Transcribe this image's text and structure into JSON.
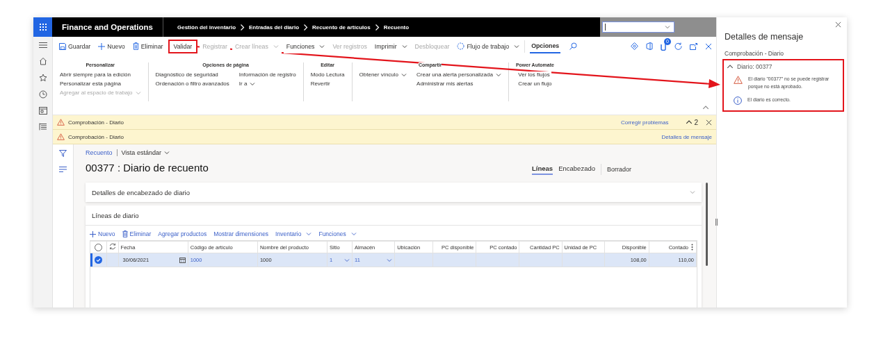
{
  "app": {
    "title": "Finance and Operations",
    "breadcrumbs": [
      "Gestión del inventario",
      "Entradas del diario",
      "Recuento de artículos",
      "Recuento"
    ],
    "notifications": "0"
  },
  "toolbar": {
    "actions": [
      {
        "kind": "save",
        "label": "Guardar",
        "disabled": false,
        "dropdown": false,
        "highlighted": false
      },
      {
        "kind": "add",
        "label": "Nuevo",
        "disabled": false,
        "dropdown": false,
        "highlighted": false
      },
      {
        "kind": "delete",
        "label": "Eliminar",
        "disabled": false,
        "dropdown": false,
        "highlighted": false
      },
      {
        "kind": "text",
        "label": "Validar",
        "disabled": false,
        "dropdown": false,
        "highlighted": true
      },
      {
        "kind": "text",
        "label": "Registrar",
        "disabled": true,
        "dropdown": false,
        "highlighted": false
      },
      {
        "kind": "text",
        "label": "Crear líneas",
        "disabled": true,
        "dropdown": true,
        "highlighted": false
      },
      {
        "kind": "text",
        "label": "Funciones",
        "disabled": false,
        "dropdown": true,
        "highlighted": false
      },
      {
        "kind": "text",
        "label": "Ver registros",
        "disabled": true,
        "dropdown": false,
        "highlighted": false
      },
      {
        "kind": "text",
        "label": "Imprimir",
        "disabled": false,
        "dropdown": true,
        "highlighted": false
      },
      {
        "kind": "text",
        "label": "Desbloquear",
        "disabled": true,
        "dropdown": false,
        "highlighted": false
      },
      {
        "kind": "workflow",
        "label": "Flujo de trabajo",
        "disabled": false,
        "dropdown": true,
        "highlighted": false
      }
    ],
    "tabs": [
      {
        "label": "Opciones",
        "selected": true
      }
    ]
  },
  "ribbon": {
    "groups": [
      {
        "title": "Personalizar",
        "columns": [
          [
            {
              "label": "Abrir siempre para la edición",
              "disabled": false,
              "dropdown": false
            },
            {
              "label": "Personalizar esta página",
              "disabled": false,
              "dropdown": false
            },
            {
              "label": "Agregar al espacio de trabajo",
              "disabled": true,
              "dropdown": true
            }
          ]
        ]
      },
      {
        "title": "Opciones de página",
        "columns": [
          [
            {
              "label": "Diagnóstico de seguridad",
              "disabled": false,
              "dropdown": false
            },
            {
              "label": "Ordenación o filtro avanzados",
              "disabled": false,
              "dropdown": false
            }
          ],
          [
            {
              "label": "Información de registro",
              "disabled": false,
              "dropdown": false
            },
            {
              "label": "Ir a",
              "disabled": false,
              "dropdown": true
            }
          ]
        ]
      },
      {
        "title": "Editar",
        "columns": [
          [
            {
              "label": "Modo Lectura",
              "disabled": false,
              "dropdown": false
            },
            {
              "label": "Revertir",
              "disabled": false,
              "dropdown": false
            }
          ]
        ]
      },
      {
        "title": "Compartir",
        "columns": [
          [
            {
              "label": "Obtener vínculo",
              "disabled": false,
              "dropdown": true
            }
          ],
          [
            {
              "label": "Crear una alerta personalizada",
              "disabled": false,
              "dropdown": true
            },
            {
              "label": "Administrar mis alertas",
              "disabled": false,
              "dropdown": false
            }
          ]
        ]
      },
      {
        "title": "Power Automate",
        "columns": [
          [
            {
              "label": "Ver los flujos",
              "disabled": false,
              "dropdown": false
            },
            {
              "label": "Crear un flujo",
              "disabled": false,
              "dropdown": false
            }
          ]
        ]
      }
    ]
  },
  "message_bars": [
    {
      "kind": "warning",
      "text": "Comprobación - Diario",
      "action": "Corregir problemas",
      "count": "2",
      "closable": true
    },
    {
      "kind": "warning",
      "text": "Comprobación - Diario",
      "action": "Detalles de mensaje",
      "closable": false
    }
  ],
  "page": {
    "breadcrumb": "Recuento",
    "view": "Vista estándar",
    "title": "00377 : Diario de recuento",
    "tabs": [
      {
        "label": "Líneas",
        "selected": true
      },
      {
        "label": "Encabezado",
        "selected": false
      }
    ],
    "status": "Borrador"
  },
  "header_section": {
    "title": "Detalles de encabezado de diario",
    "expanded": false
  },
  "lines_section": {
    "title": "Líneas de diario",
    "actions": [
      {
        "kind": "add",
        "label": "Nuevo"
      },
      {
        "kind": "delete",
        "label": "Eliminar"
      },
      {
        "kind": "text",
        "label": "Agregar productos"
      },
      {
        "kind": "text",
        "label": "Mostrar dimensiones"
      },
      {
        "kind": "menu",
        "label": "Inventario"
      },
      {
        "kind": "menu",
        "label": "Funciones"
      }
    ],
    "select_all": false,
    "columns": [
      {
        "label": "Fecha",
        "kind": "date"
      },
      {
        "label": "Código de artículo",
        "kind": "link"
      },
      {
        "label": "Nombre del producto",
        "kind": "text"
      },
      {
        "label": "Sitio",
        "kind": "select"
      },
      {
        "label": "Almacén",
        "kind": "select"
      },
      {
        "label": "Ubicación",
        "kind": "text"
      },
      {
        "label": "PC disponible",
        "kind": "number"
      },
      {
        "label": "PC contado",
        "kind": "number"
      },
      {
        "label": "Cantidad PC",
        "kind": "number"
      },
      {
        "label": "Unidad de PC",
        "kind": "text"
      },
      {
        "label": "Disponible",
        "kind": "number"
      },
      {
        "label": "Contado",
        "kind": "number"
      }
    ],
    "rows": [
      {
        "selected": true,
        "cells": [
          "30/06/2021",
          "1000",
          "1000",
          "1",
          "11",
          null,
          null,
          null,
          null,
          null,
          "108,00",
          "110,00"
        ]
      }
    ]
  },
  "message_pane": {
    "title": "Detalles de mensaje",
    "subtitle": "Comprobación - Diario",
    "groups": [
      {
        "title": "Diario: 00377",
        "expanded": true,
        "highlighted": true,
        "messages": [
          {
            "kind": "error",
            "text": "El diario \"00377\" no se puede registrar porque no está aprobado."
          },
          {
            "kind": "info",
            "text": "El diario es correcto."
          }
        ]
      }
    ]
  }
}
